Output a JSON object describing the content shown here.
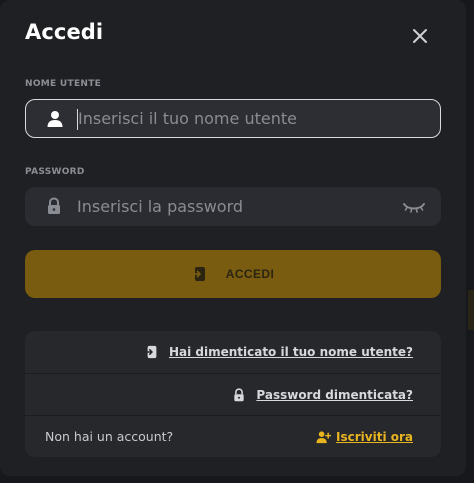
{
  "modal": {
    "title": "Accedi",
    "close_icon": "close-icon"
  },
  "username": {
    "label": "NOME UTENTE",
    "placeholder": "Inserisci il tuo nome utente",
    "value": "",
    "icon": "user-icon"
  },
  "password": {
    "label": "PASSWORD",
    "placeholder": "Inserisci la password",
    "value": "",
    "icon": "lock-icon",
    "toggle_icon": "eye-closed-icon"
  },
  "submit": {
    "label": "ACCEDI",
    "icon": "login-icon"
  },
  "links": {
    "forgot_username": "Hai dimenticato il tuo nome utente?",
    "forgot_password": "Password dimenticata?",
    "no_account": "Non hai un account?",
    "signup": "Iscriviti ora"
  },
  "colors": {
    "modal_bg": "#1f2023",
    "input_bg": "#2a2c31",
    "button_bg": "#7a5c10",
    "accent": "#e8b420",
    "text": "#ffffff"
  }
}
